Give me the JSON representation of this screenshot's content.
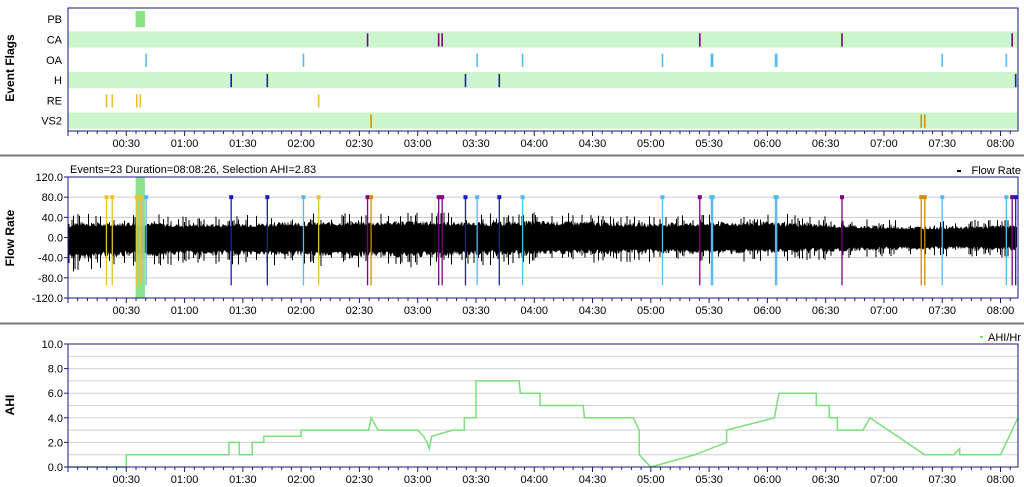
{
  "panels": {
    "event_flags": {
      "ylabel": "Event Flags",
      "rows": [
        "PB",
        "CA",
        "OA",
        "H",
        "RE",
        "VS2"
      ]
    },
    "flow_rate": {
      "ylabel": "Flow Rate",
      "header": "Events=23 Duration=08:08:26, Selection AHI=2.83",
      "legend": "Flow Rate",
      "yticks": [
        "120.0",
        "80.0",
        "40.0",
        "0.0",
        "-40.0",
        "-80.0",
        "-120.0"
      ]
    },
    "ahi": {
      "ylabel": "AHI",
      "legend": "AHI/Hr",
      "yticks": [
        "10.0",
        "8.0",
        "6.0",
        "4.0",
        "2.0",
        "0.0"
      ]
    }
  },
  "time_labels": [
    "00:30",
    "01:00",
    "01:30",
    "02:00",
    "02:30",
    "03:00",
    "03:30",
    "04:00",
    "04:30",
    "05:00",
    "05:30",
    "06:00",
    "06:30",
    "07:00",
    "07:30",
    "08:00"
  ],
  "colors": {
    "band": "#ccf7cc",
    "PB": "#88e088",
    "CA": "#800080",
    "OA": "#55bbee",
    "H": "#1a1acc",
    "RE": "#eec030",
    "VS2": "#d09000",
    "flow": "#000000",
    "ahi_line": "#7ae07a",
    "axis": "#1a1a80"
  },
  "chart_data": [
    {
      "type": "scatter",
      "name": "event_flags",
      "x_unit": "hours_since_start",
      "xlim": [
        0,
        8.15
      ],
      "events": {
        "PB": [
          {
            "start": 0.58,
            "end": 0.66
          }
        ],
        "CA": [
          2.57,
          3.18,
          3.21,
          5.42,
          6.64,
          8.1
        ],
        "OA": [
          0.67,
          2.02,
          3.51,
          3.9,
          5.1,
          5.52,
          5.53,
          6.07,
          6.08,
          7.5,
          8.05
        ],
        "H": [
          1.4,
          1.71,
          3.41,
          3.7,
          8.13
        ],
        "RE": [
          0.33,
          0.38,
          0.59,
          0.62,
          2.15
        ],
        "VS2": [
          2.6,
          7.32,
          7.35
        ]
      }
    },
    {
      "type": "line",
      "name": "flow_rate",
      "ylabel": "Flow Rate",
      "ylim": [
        -120,
        120
      ],
      "x_unit": "hours_since_start",
      "xlim": [
        0,
        8.15
      ],
      "envelope": [
        {
          "x": 0.0,
          "hi": 40,
          "lo": -65
        },
        {
          "x": 0.1,
          "hi": 50,
          "lo": -70
        },
        {
          "x": 0.3,
          "hi": 45,
          "lo": -60
        },
        {
          "x": 0.6,
          "hi": 50,
          "lo": -60
        },
        {
          "x": 1.0,
          "hi": 42,
          "lo": -55
        },
        {
          "x": 1.5,
          "hi": 45,
          "lo": -55
        },
        {
          "x": 2.0,
          "hi": 48,
          "lo": -58
        },
        {
          "x": 2.5,
          "hi": 50,
          "lo": -60
        },
        {
          "x": 3.0,
          "hi": 52,
          "lo": -62
        },
        {
          "x": 3.5,
          "hi": 48,
          "lo": -55
        },
        {
          "x": 4.0,
          "hi": 52,
          "lo": -55
        },
        {
          "x": 4.5,
          "hi": 50,
          "lo": -52
        },
        {
          "x": 5.0,
          "hi": 45,
          "lo": -50
        },
        {
          "x": 5.5,
          "hi": 48,
          "lo": -52
        },
        {
          "x": 6.0,
          "hi": 50,
          "lo": -50
        },
        {
          "x": 6.5,
          "hi": 42,
          "lo": -45
        },
        {
          "x": 7.0,
          "hi": 35,
          "lo": -40
        },
        {
          "x": 7.5,
          "hi": 35,
          "lo": -38
        },
        {
          "x": 8.0,
          "hi": 38,
          "lo": -40
        },
        {
          "x": 8.15,
          "hi": 38,
          "lo": -40
        }
      ]
    },
    {
      "type": "line",
      "name": "ahi",
      "ylabel": "AHI",
      "ylim": [
        0,
        10
      ],
      "x_unit": "hours_since_start",
      "xlim": [
        0,
        8.15
      ],
      "series": [
        {
          "name": "AHI/Hr",
          "x": [
            0,
            0.5,
            0.5,
            1.38,
            1.38,
            1.47,
            1.47,
            1.58,
            1.58,
            1.68,
            1.68,
            2.0,
            2.0,
            2.58,
            2.6,
            2.66,
            2.68,
            3.0,
            3.05,
            3.08,
            3.1,
            3.12,
            3.3,
            3.4,
            3.4,
            3.5,
            3.5,
            3.87,
            3.88,
            4.05,
            4.05,
            4.42,
            4.43,
            4.85,
            4.9,
            4.9,
            5.0,
            5.0,
            5.38,
            5.38,
            5.65,
            5.65,
            6.06,
            6.1,
            6.42,
            6.42,
            6.53,
            6.53,
            6.6,
            6.6,
            6.82,
            6.88,
            6.88,
            7.35,
            7.35,
            7.6,
            7.65,
            7.65,
            8.0,
            8.15
          ],
          "y": [
            0,
            0,
            1,
            1,
            2,
            2,
            1,
            1,
            2,
            2,
            2.5,
            2.5,
            3,
            3,
            4,
            3,
            3,
            3,
            2.5,
            2,
            1.5,
            2.5,
            3,
            3,
            4,
            4,
            7,
            7,
            6,
            6,
            5,
            5,
            4,
            4,
            3,
            1,
            0,
            0,
            1,
            1,
            2,
            3,
            4,
            6,
            6,
            5,
            5,
            4,
            4,
            3,
            3,
            4,
            4,
            1,
            1,
            1,
            1.5,
            1,
            1,
            4
          ]
        }
      ]
    }
  ]
}
